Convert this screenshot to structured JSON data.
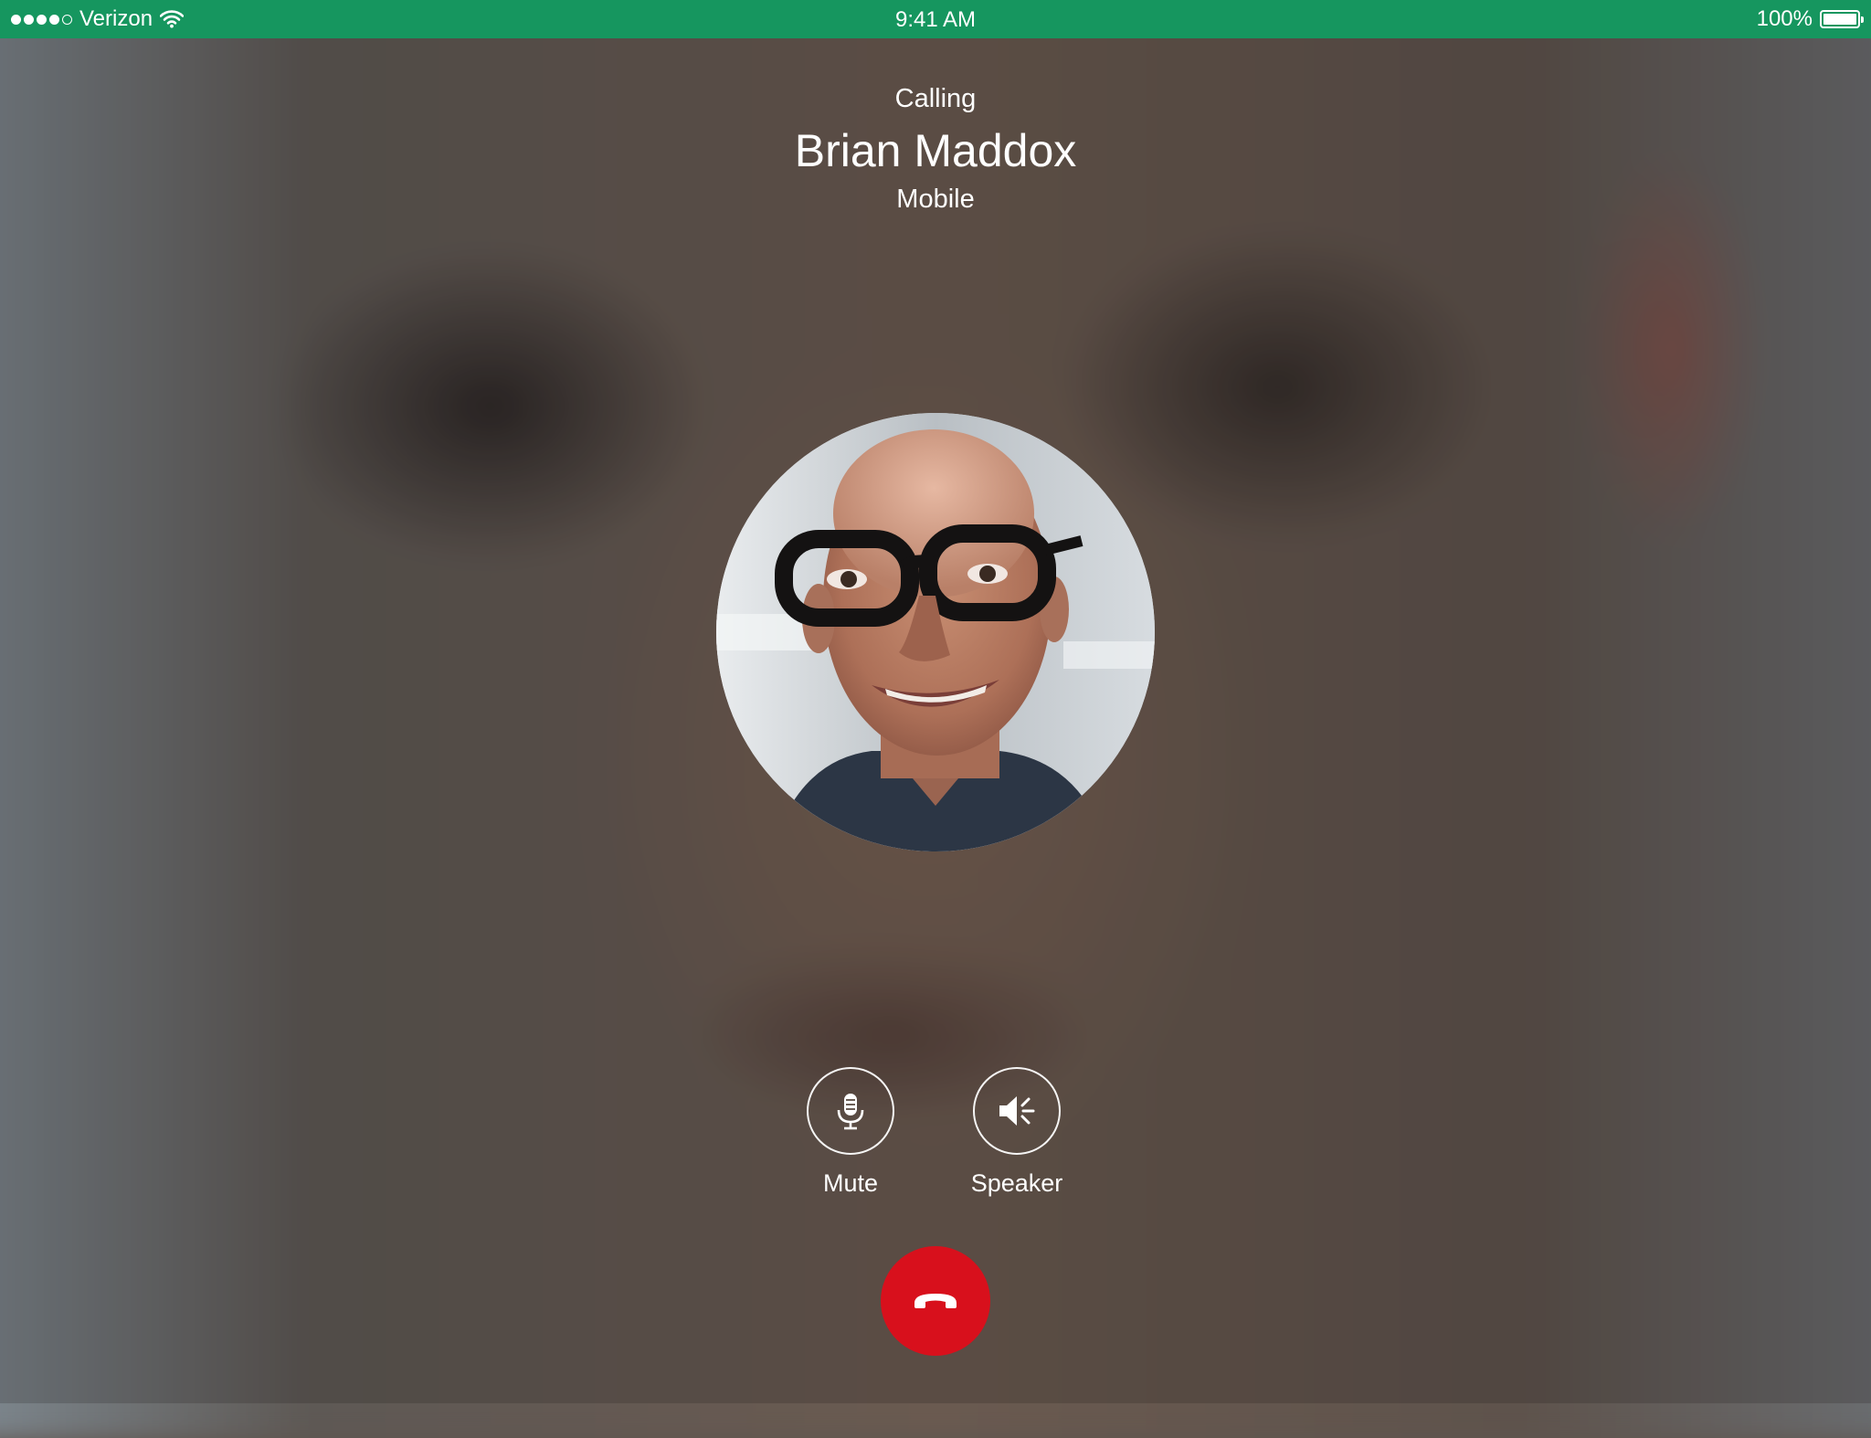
{
  "status_bar": {
    "carrier": "Verizon",
    "signal_bars_filled": 4,
    "signal_bars_total": 5,
    "time": "9:41 AM",
    "battery_percent": "100%",
    "battery_level": 1.0,
    "icons": [
      "wifi-icon",
      "battery-icon"
    ],
    "background_color": "#16965f"
  },
  "call": {
    "state": "Calling",
    "caller_name": "Brian Maddox",
    "caller_label": "Mobile"
  },
  "controls": {
    "mute_label": "Mute",
    "mute_icon": "microphone-icon",
    "speaker_label": "Speaker",
    "speaker_icon": "speaker-icon",
    "end_call_icon": "phone-hangup-icon",
    "end_call_color": "#d8101c"
  }
}
